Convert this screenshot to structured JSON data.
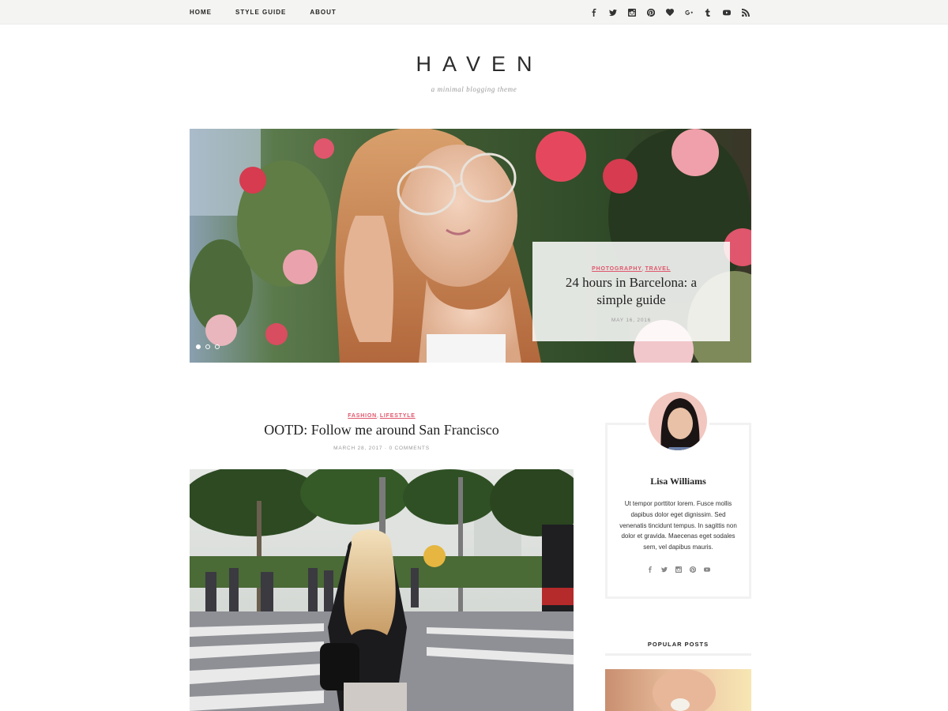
{
  "nav": {
    "items": [
      {
        "label": "HOME"
      },
      {
        "label": "STYLE GUIDE"
      },
      {
        "label": "ABOUT"
      }
    ],
    "social_icons": [
      "facebook-icon",
      "twitter-icon",
      "instagram-icon",
      "pinterest-icon",
      "heart-icon",
      "google-plus-icon",
      "tumblr-icon",
      "youtube-icon",
      "rss-icon"
    ]
  },
  "header": {
    "logo": "HAVEN",
    "tagline": "a minimal blogging theme"
  },
  "slider": {
    "categories": [
      "PHOTOGRAPHY",
      "TRAVEL"
    ],
    "title": "24 hours in Barcelona: a simple guide",
    "date": "MAY 16, 2016",
    "slide_count": 3,
    "active_slide": 1
  },
  "post": {
    "categories": [
      "FASHION",
      "LIFESTYLE"
    ],
    "title": "OOTD: Follow me around San Francisco",
    "meta": "MARCH 28, 2017 · 0 COMMENTS"
  },
  "sidebar": {
    "author_name": "Lisa Williams",
    "author_bio": "Ut tempor porttitor lorem. Fusce mollis dapibus dolor eget dignissim. Sed venenatis tincidunt tempus. In sagittis non dolor et gravida. Maecenas eget sodales sem, vel dapibus mauris.",
    "author_social_icons": [
      "facebook-icon",
      "twitter-icon",
      "instagram-icon",
      "pinterest-icon",
      "youtube-icon"
    ],
    "popular_title": "POPULAR POSTS"
  },
  "colors": {
    "accent": "#e0566c",
    "topbar_bg": "#f4f4f2",
    "meta_gray": "#9a9a9a"
  }
}
